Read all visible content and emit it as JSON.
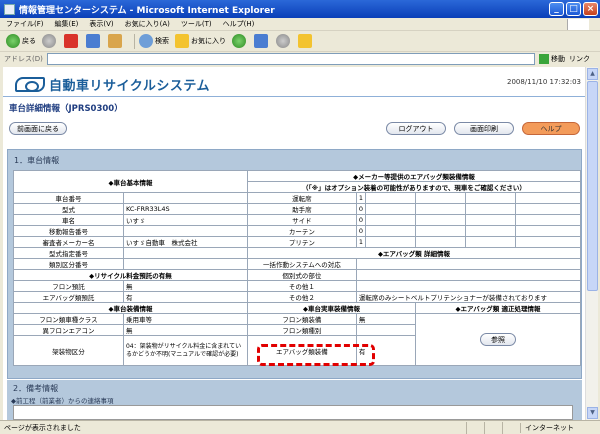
{
  "window": {
    "title": "情報管理センターシステム - Microsoft Internet Explorer"
  },
  "menu": [
    "ファイル(F)",
    "編集(E)",
    "表示(V)",
    "お気に入り(A)",
    "ツール(T)",
    "ヘルプ(H)"
  ],
  "toolbar": {
    "back": "戻る",
    "search": "検索",
    "favorites": "お気に入り"
  },
  "address": {
    "label": "アドレス(D)",
    "go": "移動",
    "links": "リンク"
  },
  "page": {
    "logo_text": "自動車リサイクルシステム",
    "datetime": "2008/11/10 17:32:03",
    "screen_title": "車台詳細情報（JPRS0300）",
    "buttons": {
      "back_to_prev": "前画面に戻る",
      "logout": "ログアウト",
      "print": "画面印刷",
      "help": "ヘルプ"
    },
    "section1_title": "1．車台情報",
    "section2_title": "2．備考情報",
    "section2_sub": "◆前工程（前業者）からの連絡事項"
  },
  "table": {
    "basic_header": "◆車台基本情報",
    "maker_header_1": "◆メーカー等提供のエアバッグ類装備情報",
    "maker_header_2": "（「※」はオプション装着の可能性がありますので、現車をご確認ください）",
    "basic_rows": [
      {
        "label": "車台番号",
        "value": ""
      },
      {
        "label": "型式",
        "value": "KC-FRR33L4S"
      },
      {
        "label": "車名",
        "value": "いすゞ"
      },
      {
        "label": "移動報告番号",
        "value": ""
      },
      {
        "label": "審査者メーカー名",
        "value": "いすゞ自動車　株式会社"
      },
      {
        "label": "型式指定番号",
        "value": ""
      },
      {
        "label": "類別区分番号",
        "value": ""
      }
    ],
    "airbag_rows": [
      {
        "label": "運転席",
        "value": "1"
      },
      {
        "label": "助手席",
        "value": "0"
      },
      {
        "label": "サイド",
        "value": "0"
      },
      {
        "label": "カーテン",
        "value": "0"
      },
      {
        "label": "プリテン",
        "value": "1"
      }
    ],
    "airbag_detail_header": "◆エアバッグ類 詳細情報",
    "detail_rows": [
      {
        "label": "一括作動システムへの対応",
        "value": ""
      },
      {
        "label": "個別式の部位",
        "value": ""
      },
      {
        "label": "その他１",
        "value": ""
      },
      {
        "label": "その他２",
        "value": "運転席のみシートベルトプリテンショナーが装備されております"
      }
    ],
    "recycle_header": "◆リサイクル料金預託の有無",
    "recycle_rows": [
      {
        "label": "フロン預託",
        "value": "無"
      },
      {
        "label": "エアバッグ類預託",
        "value": "有"
      }
    ],
    "equip_header": "◆車台装備情報",
    "actual_header": "◆車台実車装備情報",
    "proper_header": "◆エアバッグ類 適正処理情報",
    "equip_rows": [
      {
        "label": "フロン類車種クラス",
        "value": "乗用車等"
      },
      {
        "label": "異フロンエアコン",
        "value": "無"
      },
      {
        "label": "架装物区分",
        "value": "04：架装物がリサイクル料金に含まれているかどうか不明(マニュアルで確認が必要)"
      }
    ],
    "actual_rows": [
      {
        "label": "フロン類装備",
        "value": "無"
      },
      {
        "label": "フロン類種別",
        "value": ""
      },
      {
        "label": "エアバッグ類装備",
        "value": "有"
      }
    ],
    "reference_button": "参照"
  },
  "status": {
    "message": "ページが表示されました",
    "zone": "インターネット"
  }
}
